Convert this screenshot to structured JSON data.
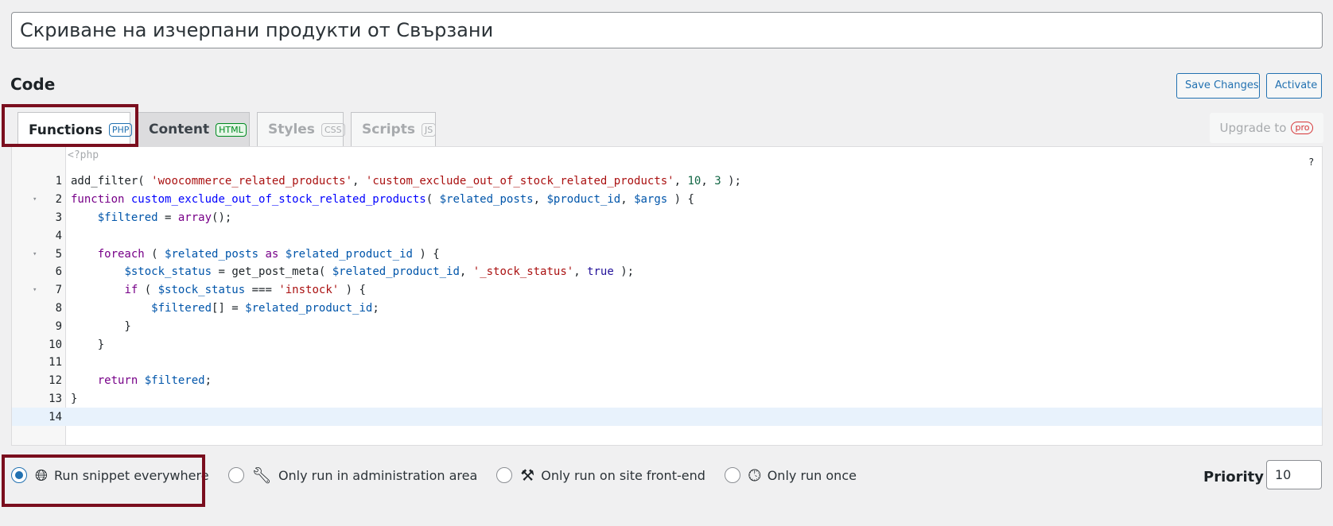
{
  "snippet": {
    "title": "Скриване на изчерпани продукти от Свързани"
  },
  "code_section": {
    "title": "Code"
  },
  "actions": {
    "save_label": "Save Changes",
    "activate_label": "Activate"
  },
  "tabs": [
    {
      "label": "Functions",
      "badge": "PHP",
      "active": true
    },
    {
      "label": "Content",
      "badge": "HTML",
      "active": false
    },
    {
      "label": "Styles",
      "badge": "CSS",
      "active": false
    },
    {
      "label": "Scripts",
      "badge": "JS",
      "active": false
    }
  ],
  "upgrade": {
    "label": "Upgrade to",
    "badge": "pro"
  },
  "editor": {
    "php_open_tag": "<?php",
    "help": "?",
    "lines": [
      {
        "num": "1",
        "fold": ""
      },
      {
        "num": "2",
        "fold": "▾"
      },
      {
        "num": "3",
        "fold": ""
      },
      {
        "num": "4",
        "fold": ""
      },
      {
        "num": "5",
        "fold": "▾"
      },
      {
        "num": "6",
        "fold": ""
      },
      {
        "num": "7",
        "fold": "▾"
      },
      {
        "num": "8",
        "fold": ""
      },
      {
        "num": "9",
        "fold": ""
      },
      {
        "num": "10",
        "fold": ""
      },
      {
        "num": "11",
        "fold": ""
      },
      {
        "num": "12",
        "fold": ""
      },
      {
        "num": "13",
        "fold": ""
      },
      {
        "num": "14",
        "fold": ""
      }
    ],
    "tokens": {
      "l1_fn": "add_filter",
      "l1_s1": "'woocommerce_related_products'",
      "l1_s2": "'custom_exclude_out_of_stock_related_products'",
      "l1_n1": "10",
      "l1_n2": "3",
      "kw_function": "function",
      "l2_name": "custom_exclude_out_of_stock_related_products",
      "v_related_posts": "$related_posts",
      "v_product_id": "$product_id",
      "v_args": "$args",
      "v_filtered": "$filtered",
      "l3_array": "array",
      "kw_foreach": "foreach",
      "kw_as": "as",
      "v_related_product_id": "$related_product_id",
      "v_stock_status": "$stock_status",
      "l6_fn": "get_post_meta",
      "l6_s": "'_stock_status'",
      "atom_true": "true",
      "kw_if": "if",
      "l7_s": "'instock'",
      "kw_return": "return"
    }
  },
  "run_options": [
    {
      "label": "Run snippet everywhere",
      "icon": "globe-icon",
      "checked": true
    },
    {
      "label": "Only run in administration area",
      "icon": "wrench-icon",
      "checked": false
    },
    {
      "label": "Only run on site front-end",
      "icon": "hammer-icon",
      "checked": false
    },
    {
      "label": "Only run once",
      "icon": "clock-icon",
      "checked": false
    }
  ],
  "priority": {
    "label": "Priority",
    "value": "10"
  },
  "colors": {
    "accent": "#2271b1",
    "highlight": "#7a0e1e"
  }
}
